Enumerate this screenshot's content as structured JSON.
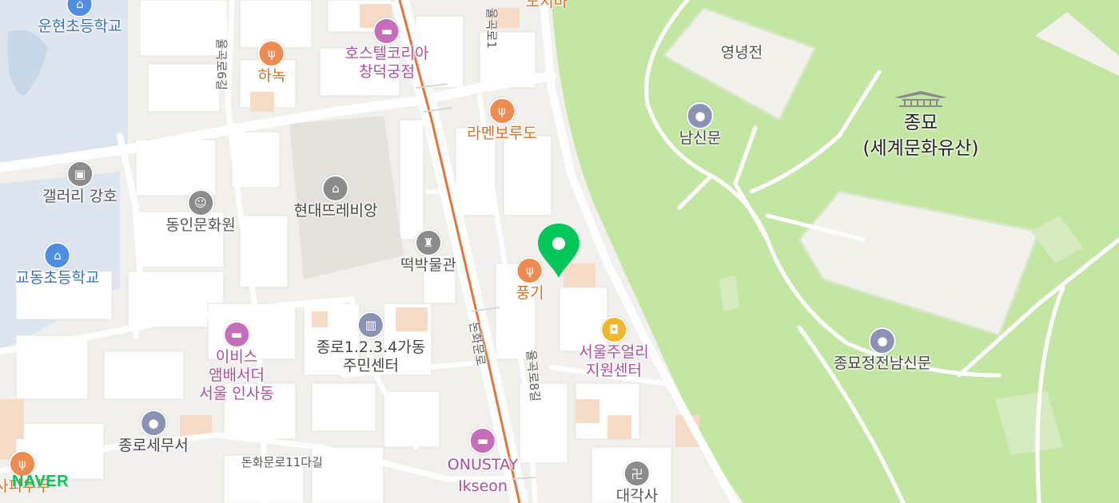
{
  "map": {
    "logo": "NAVER",
    "colors": {
      "park": "#c4e6a3",
      "block": "#ffffff",
      "road": "#e9e8e4",
      "main_road_line": "#e8733a",
      "marker": "#03c75a",
      "food": "#ec8c52",
      "lodging": "#c56fbb",
      "public": "#8b93b4",
      "culture": "#8c8c8c",
      "school": "#4f8de0",
      "shopping": "#f0b62c"
    },
    "selected_marker": {
      "icon": "map-pin-icon"
    },
    "landmark": {
      "icon": "temple-roof-icon",
      "name": "종묘",
      "subtitle": "(세계문화유산)"
    },
    "pois": [
      {
        "id": "undong",
        "name": "운현초등학교",
        "category": "school",
        "icon": "school-icon"
      },
      {
        "id": "hanok",
        "name": "하녹",
        "category": "food",
        "icon": "fork-knife-icon"
      },
      {
        "id": "hostel",
        "name": "호스텔코리아\n창덕궁점",
        "category": "lodging",
        "icon": "bed-icon"
      },
      {
        "id": "ramen",
        "name": "라멘보루도",
        "category": "food",
        "icon": "fork-knife-icon"
      },
      {
        "id": "gallery",
        "name": "갤러리 강호",
        "category": "culture",
        "icon": "picture-icon"
      },
      {
        "id": "dongin",
        "name": "동인문화원",
        "category": "culture",
        "icon": "mask-icon"
      },
      {
        "id": "hyundai",
        "name": "현대뜨레비앙",
        "category": "culture",
        "icon": "building-icon"
      },
      {
        "id": "tteok",
        "name": "떡박물관",
        "category": "culture",
        "icon": "museum-icon"
      },
      {
        "id": "gyodong",
        "name": "교동초등학교",
        "category": "school",
        "icon": "school-icon"
      },
      {
        "id": "pungi",
        "name": "풍기",
        "category": "food",
        "icon": "fork-knife-icon"
      },
      {
        "id": "jongro1234",
        "name": "종로1.2.3.4가동\n주민센터",
        "category": "public",
        "icon": "government-icon"
      },
      {
        "id": "ibis",
        "name": "이비스\n앰배서더\n서울 인사동",
        "category": "lodging",
        "icon": "bed-icon"
      },
      {
        "id": "jewelry",
        "name": "서울주얼리\n지원센터",
        "category": "lodging",
        "icon": "shopping-bag-icon"
      },
      {
        "id": "tax",
        "name": "종로세무서",
        "category": "public",
        "icon": "circle-icon"
      },
      {
        "id": "onustay",
        "name": "ONUSTAY\nIkseon",
        "category": "lodging",
        "icon": "bed-icon"
      },
      {
        "id": "daegaksa",
        "name": "대각사",
        "category": "culture",
        "icon": "swastika-icon"
      },
      {
        "id": "yeongnyeong",
        "name": "영녕전",
        "category": "label",
        "icon": ""
      },
      {
        "id": "namsin",
        "name": "남신문",
        "category": "public",
        "icon": "circle-icon"
      },
      {
        "id": "jongmyo_gate",
        "name": "종묘정전남신문",
        "category": "public",
        "icon": "circle-icon"
      },
      {
        "id": "partial_top",
        "name": "도지마",
        "category": "food",
        "icon": ""
      },
      {
        "id": "partial_left",
        "name": "사피우두",
        "category": "food",
        "icon": "fork-knife-icon"
      }
    ],
    "roads": [
      {
        "id": "r1",
        "name": "율곡로6길"
      },
      {
        "id": "r2",
        "name": "돈화문로"
      },
      {
        "id": "r3",
        "name": "율곡로8길"
      },
      {
        "id": "r4",
        "name": "돈화문로11다길"
      },
      {
        "id": "r5",
        "name": "율곡로1"
      }
    ]
  }
}
